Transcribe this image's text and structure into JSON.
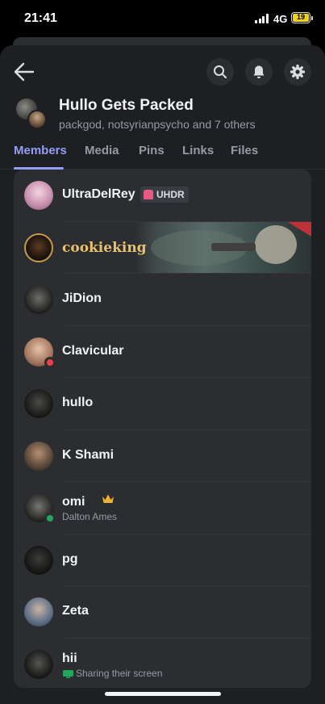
{
  "status_bar": {
    "time": "21:41",
    "network": "4G",
    "battery": "19"
  },
  "header": {
    "title": "Hullo Gets Packed",
    "subtitle": "packgod, notsyrianpsycho and 7 others"
  },
  "tabs": [
    {
      "label": "Members",
      "active": true
    },
    {
      "label": "Media",
      "active": false
    },
    {
      "label": "Pins",
      "active": false
    },
    {
      "label": "Links",
      "active": false
    },
    {
      "label": "Files",
      "active": false
    }
  ],
  "members": [
    {
      "name": "UltraDelRey",
      "tag": "UHDR"
    },
    {
      "name": "cookieking"
    },
    {
      "name": "JiDion"
    },
    {
      "name": "Clavicular",
      "status": "dnd"
    },
    {
      "name": "hullo"
    },
    {
      "name": "K Shami"
    },
    {
      "name": "omi",
      "status": "online",
      "owner": true,
      "activity": "Dalton Ames"
    },
    {
      "name": "pg"
    },
    {
      "name": "Zeta"
    },
    {
      "name": "hii",
      "activity": "Sharing their screen"
    }
  ],
  "colors": {
    "accent": "#949cf7",
    "online": "#23a55a",
    "dnd": "#f23f43",
    "crown": "#f0b232"
  }
}
